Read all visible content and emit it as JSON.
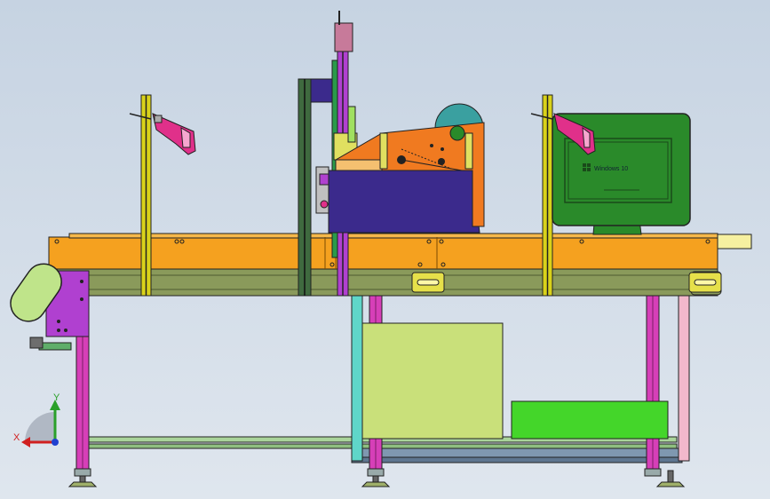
{
  "monitor": {
    "screen_text": "Windows 10"
  },
  "triad": {
    "x_label": "X",
    "y_label": "Y"
  },
  "colors": {
    "background_top": "#c6d3e2",
    "background_bottom": "#dfe6ee",
    "conveyor_orange": "#f5a11f",
    "conveyor_rail": "#8a9a5b",
    "frame_magenta": "#d63fb8",
    "labeler_orange": "#f07a20",
    "labeler_base": "#3b2a8c",
    "monitor_green": "#2a8a2a",
    "bin_lightgreen": "#c9e07a",
    "bin_green": "#44d62a",
    "scanner_pink": "#e0308a",
    "pole_yellow": "#d9d21a",
    "guard_purple": "#b040d0"
  }
}
